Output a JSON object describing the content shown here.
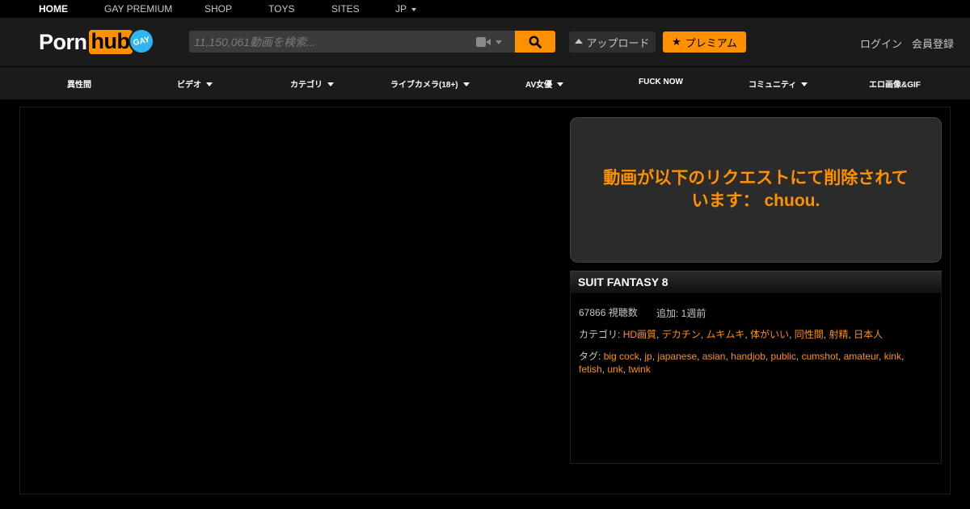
{
  "topbar": {
    "items": [
      {
        "label": "HOME",
        "active": true
      },
      {
        "label": "GAY PREMIUM"
      },
      {
        "label": "SHOP"
      },
      {
        "label": "TOYS"
      },
      {
        "label": "SITES"
      },
      {
        "label": "JP"
      }
    ]
  },
  "header": {
    "logo_porn": "Porn",
    "logo_hub": "hub",
    "logo_gay": "GAY",
    "search_placeholder": "11,150,061動画を検索...",
    "upload_label": "アップロード",
    "premium_label": "プレミアム",
    "login_label": "ログイン",
    "signup_label": "会員登録"
  },
  "mainnav": {
    "items": [
      {
        "label": "異性間"
      },
      {
        "label": "ビデオ"
      },
      {
        "label": "カテゴリ"
      },
      {
        "label": "ライブカメラ(18+)"
      },
      {
        "label": "AV女優"
      },
      {
        "label": "FUCK NOW"
      },
      {
        "label": "コミュニティ"
      },
      {
        "label": "エロ画像&GIF"
      }
    ]
  },
  "video": {
    "removed_message": "動画が以下のリクエストにて削除されています： chuou.",
    "title": "SUIT FANTASY 8",
    "views": "67866 視聴数",
    "added": "追加: 1週前",
    "categories_label": "カテゴリ:",
    "categories": [
      "HD画質",
      "デカチン",
      "ムキムキ",
      "体がいい",
      "同性間",
      "射精",
      "日本人"
    ],
    "tags_label": "タグ:",
    "tags": [
      "big cock",
      "jp",
      "japanese",
      "asian",
      "handjob",
      "public",
      "cumshot",
      "amateur",
      "kink",
      "fetish",
      "unk",
      "twink"
    ]
  },
  "colors": {
    "accent": "#ff9000",
    "gay_badge": "#2cb5f0",
    "background": "#000000",
    "header_bg": "#1b1b1b"
  },
  "icons": {
    "search": "magnifier-icon",
    "camera": "video-camera-icon",
    "upload": "upload-arrow-icon",
    "premium": "star-icon"
  }
}
